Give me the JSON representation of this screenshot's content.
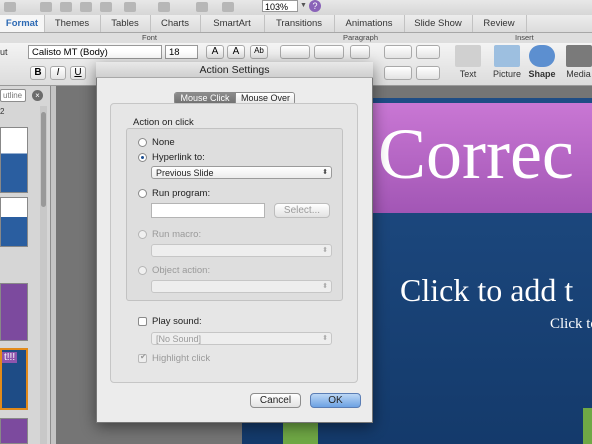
{
  "toolbar": {
    "zoom": "103%",
    "help": "?"
  },
  "ribbon_tabs": [
    {
      "label": "Format",
      "active": true
    },
    {
      "label": "Themes"
    },
    {
      "label": "Tables"
    },
    {
      "label": "Charts"
    },
    {
      "label": "SmartArt"
    },
    {
      "label": "Transitions"
    },
    {
      "label": "Animations"
    },
    {
      "label": "Slide Show"
    },
    {
      "label": "Review"
    }
  ],
  "ribbon_groups": {
    "font": "Font",
    "paragraph": "Paragraph",
    "insert": "Insert"
  },
  "ribbon": {
    "left_label": "ut",
    "font_name": "Calisto MT (Body)",
    "font_size": "18",
    "bold": "B",
    "italic": "I",
    "underline": "U",
    "grow": "A",
    "shrink": "A",
    "change_case": "Ab",
    "insert_items": [
      "Text",
      "Picture",
      "Shape",
      "Media"
    ]
  },
  "left_panel": {
    "outline_label": "utline",
    "slide_number": "2",
    "thumb_text": "t!!!"
  },
  "slide": {
    "title": "Correc",
    "subtitle": "Click to add t",
    "subtitle2": "Click to"
  },
  "dialog": {
    "title": "Action Settings",
    "tabs": [
      "Mouse Click",
      "Mouse Over"
    ],
    "group_title": "Action on click",
    "none_label": "None",
    "hyperlink_label": "Hyperlink to:",
    "hyperlink_value": "Previous Slide",
    "run_program_label": "Run program:",
    "run_program_value": "",
    "select_button": "Select...",
    "run_macro_label": "Run macro:",
    "object_action_label": "Object action:",
    "play_sound_label": "Play sound:",
    "sound_value": "[No Sound]",
    "highlight_label": "Highlight click",
    "cancel": "Cancel",
    "ok": "OK"
  }
}
